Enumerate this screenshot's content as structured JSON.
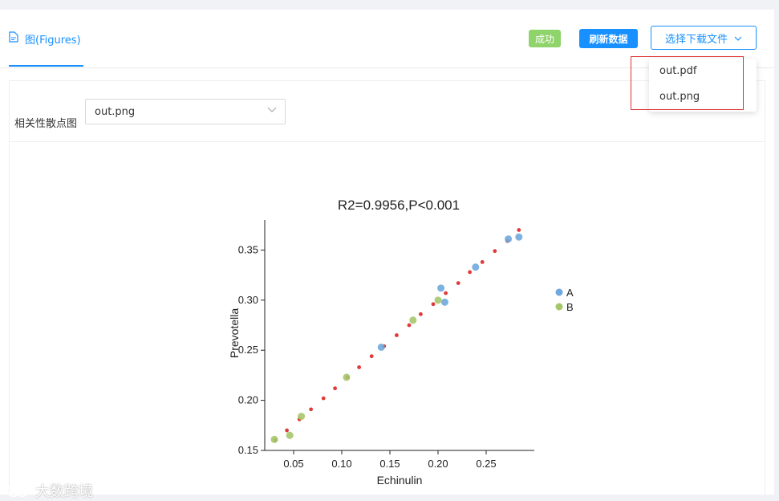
{
  "tab": {
    "label": "图(Figures)",
    "icon": "document-icon"
  },
  "status_badge": "成功",
  "refresh_button": "刷新数据",
  "download_button": {
    "label": "选择下载文件",
    "icon": "chevron-down-icon"
  },
  "download_menu": {
    "items": [
      "out.pdf",
      "out.png"
    ]
  },
  "selector": {
    "label": "相关性散点图",
    "value": "out.png"
  },
  "watermark": "大数跨境",
  "colors": {
    "accent": "#1890ff",
    "success": "#8fd36b",
    "series_a": "#6fa8dc",
    "series_b": "#a5c76b",
    "fit": "#e03a3a"
  },
  "chart_data": {
    "type": "scatter",
    "title": "R2=0.9956,P<0.001",
    "xlabel": "Echinulin",
    "ylabel": "Prevotella",
    "xlim": [
      0.02,
      0.3
    ],
    "ylim": [
      0.15,
      0.38
    ],
    "xticks": [
      "0.05",
      "0.10",
      "0.15",
      "0.20",
      "0.25"
    ],
    "yticks": [
      "0.15",
      "0.20",
      "0.25",
      "0.30",
      "0.35"
    ],
    "legend_position": "right",
    "series": [
      {
        "name": "A",
        "color": "#6fa8dc",
        "points": [
          [
            0.141,
            0.253
          ],
          [
            0.203,
            0.312
          ],
          [
            0.207,
            0.298
          ],
          [
            0.239,
            0.333
          ],
          [
            0.273,
            0.361
          ],
          [
            0.284,
            0.363
          ]
        ]
      },
      {
        "name": "B",
        "color": "#a5c76b",
        "points": [
          [
            0.03,
            0.161
          ],
          [
            0.046,
            0.165
          ],
          [
            0.058,
            0.184
          ],
          [
            0.105,
            0.223
          ],
          [
            0.174,
            0.28
          ],
          [
            0.2,
            0.3
          ]
        ]
      }
    ],
    "fit_line": {
      "color": "#e03a3a",
      "x": [
        0.031,
        0.043,
        0.056,
        0.068,
        0.081,
        0.093,
        0.106,
        0.118,
        0.131,
        0.144,
        0.157,
        0.17,
        0.182,
        0.195,
        0.208,
        0.221,
        0.233,
        0.246,
        0.259,
        0.272,
        0.284
      ],
      "y": [
        0.16,
        0.17,
        0.181,
        0.191,
        0.202,
        0.212,
        0.223,
        0.233,
        0.244,
        0.254,
        0.265,
        0.275,
        0.286,
        0.296,
        0.307,
        0.317,
        0.328,
        0.338,
        0.349,
        0.359,
        0.37
      ]
    }
  }
}
